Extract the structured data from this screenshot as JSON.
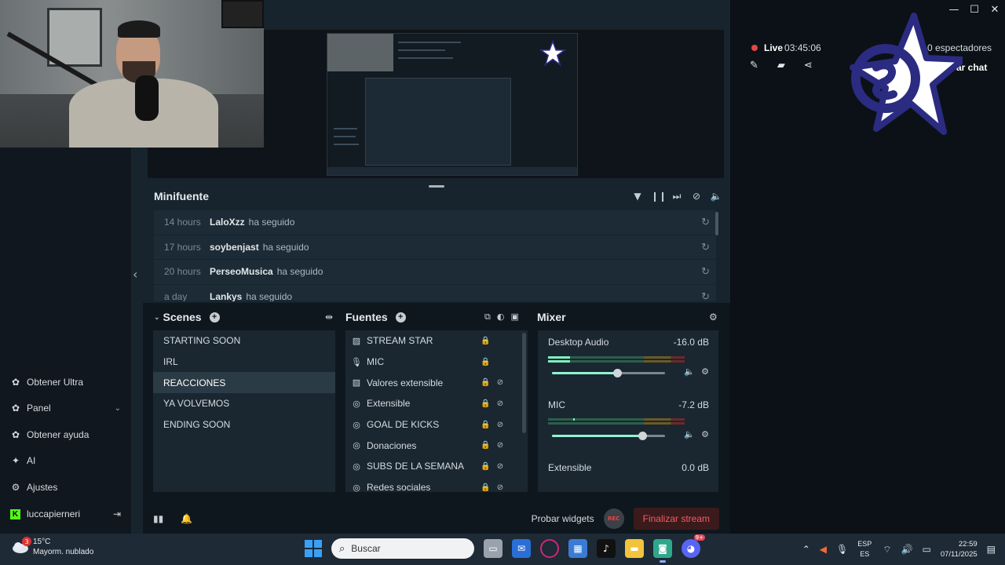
{
  "window": {
    "minimize": "—",
    "maximize": "☐",
    "close": "✕"
  },
  "sidebar": {
    "items": [
      {
        "label": "Obtener Ultra",
        "icon": "ultra-icon"
      },
      {
        "label": "Panel",
        "icon": "panel-icon"
      },
      {
        "label": "Obtener ayuda",
        "icon": "help-icon"
      },
      {
        "label": "AI",
        "icon": "ai-sparkle-icon"
      },
      {
        "label": "Ajustes",
        "icon": "gear-icon"
      }
    ],
    "user": "luccapierneri"
  },
  "minifeed": {
    "title": "Minifuente",
    "events": [
      {
        "time": "14 hours",
        "user": "LaloXzz",
        "action": "ha seguido"
      },
      {
        "time": "17 hours",
        "user": "soybenjast",
        "action": "ha seguido"
      },
      {
        "time": "20 hours",
        "user": "PerseoMusica",
        "action": "ha seguido"
      },
      {
        "time": "a day",
        "user": "Lankys",
        "action": "ha seguido"
      }
    ]
  },
  "scenes": {
    "title": "Scenes",
    "items": [
      "STARTING SOON",
      "IRL",
      "REACCIONES",
      "YA VOLVEMOS",
      "ENDING SOON"
    ],
    "active": "REACCIONES"
  },
  "sources": {
    "title": "Fuentes",
    "items": [
      {
        "name": "STREAM STAR",
        "icon": "image-icon",
        "hidden": false
      },
      {
        "name": "MIC",
        "icon": "mic-icon",
        "hidden": false
      },
      {
        "name": "Valores extensible",
        "icon": "image-icon",
        "hidden": true
      },
      {
        "name": "Extensible",
        "icon": "globe-icon",
        "hidden": true
      },
      {
        "name": "GOAL DE KICKS",
        "icon": "globe-icon",
        "hidden": true
      },
      {
        "name": "Donaciones",
        "icon": "globe-icon",
        "hidden": true
      },
      {
        "name": "SUBS DE LA SEMANA",
        "icon": "globe-icon",
        "hidden": true
      },
      {
        "name": "Redes sociales",
        "icon": "globe-icon",
        "hidden": true
      }
    ]
  },
  "mixer": {
    "title": "Mixer",
    "channels": [
      {
        "name": "Desktop Audio",
        "db": "-16.0 dB",
        "level": 0.58
      },
      {
        "name": "MIC",
        "db": "-7.2 dB",
        "level": 0.8
      },
      {
        "name": "Extensible",
        "db": "0.0 dB",
        "level": 1.0
      }
    ]
  },
  "footer": {
    "test_widgets": "Probar widgets",
    "rec": "REC",
    "end_stream": "Finalizar stream"
  },
  "stream": {
    "live_label": "Live",
    "duration": "03:45:06",
    "viewers": "0 espectadores",
    "chat_button": "ar chat"
  },
  "taskbar": {
    "temp": "15°C",
    "weather": "Mayorm. nublado",
    "weather_badge": "3",
    "search_placeholder": "Buscar",
    "lang_top": "ESP",
    "lang_bottom": "ES",
    "time": "22:59",
    "date": "07/11/2025",
    "discord_badge": "9+"
  },
  "colors": {
    "accent": "#8ff3cf",
    "live_dot": "#e34648",
    "end_stream": "#f25c63",
    "kick_green": "#53fc18"
  }
}
